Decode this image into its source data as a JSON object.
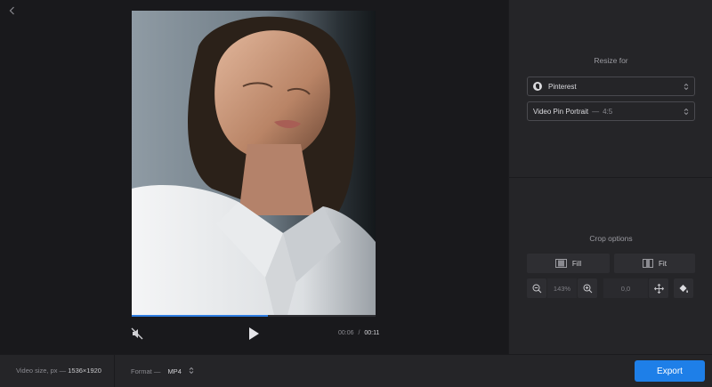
{
  "player": {
    "current_time": "00:06",
    "time_separator": "/",
    "total_time": "00:11",
    "progress_fraction": 0.56
  },
  "resize": {
    "title": "Resize for",
    "platform": "Pinterest",
    "platform_icon": "pinterest-icon",
    "preset_name": "Video Pin Portrait",
    "preset_separator": "—",
    "preset_ratio": "4:5"
  },
  "crop": {
    "title": "Crop options",
    "fill_label": "Fill",
    "fit_label": "Fit",
    "zoom_value": "143%",
    "position_value": "0,0"
  },
  "footer": {
    "video_size_label": "Video size, px —",
    "video_size_value": "1536×1920",
    "format_label": "Format —",
    "format_value": "MP4",
    "export_label": "Export"
  },
  "colors": {
    "accent": "#1e7fe8",
    "progress": "#2f7de1",
    "background": "#19191c",
    "panel": "#252528"
  }
}
